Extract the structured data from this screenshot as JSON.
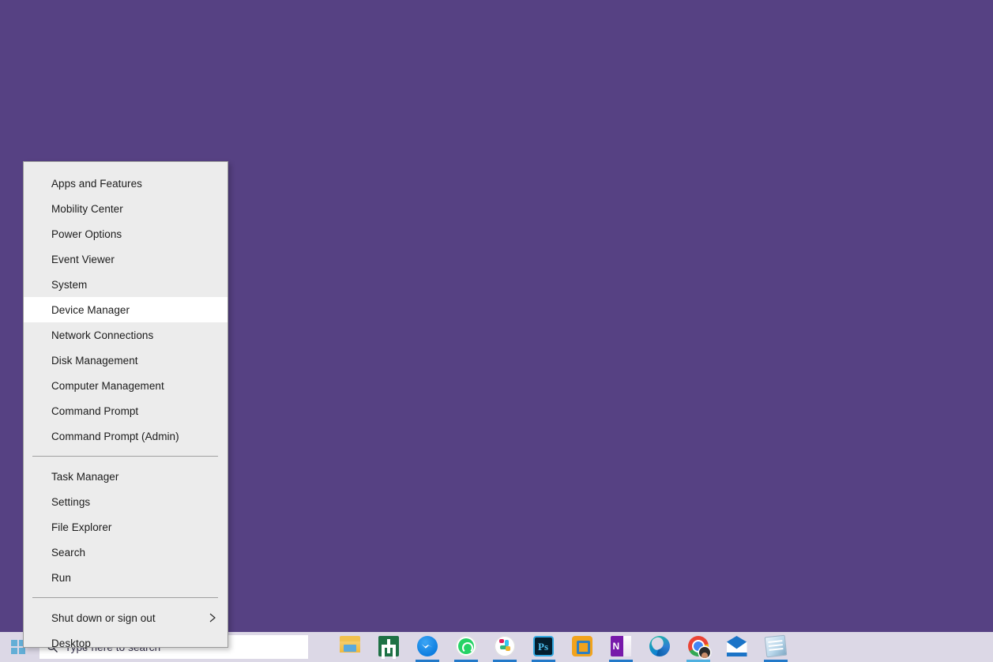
{
  "desktop": {
    "background_color": "#564183"
  },
  "power_menu": {
    "name": "Windows power user menu",
    "background_color": "#ececec",
    "highlight_color": "#ffffff",
    "groups": [
      {
        "items": [
          {
            "label": "Apps and Features",
            "selected": false,
            "submenu": false
          },
          {
            "label": "Mobility Center",
            "selected": false,
            "submenu": false
          },
          {
            "label": "Power Options",
            "selected": false,
            "submenu": false
          },
          {
            "label": "Event Viewer",
            "selected": false,
            "submenu": false
          },
          {
            "label": "System",
            "selected": false,
            "submenu": false
          },
          {
            "label": "Device Manager",
            "selected": true,
            "submenu": false
          },
          {
            "label": "Network Connections",
            "selected": false,
            "submenu": false
          },
          {
            "label": "Disk Management",
            "selected": false,
            "submenu": false
          },
          {
            "label": "Computer Management",
            "selected": false,
            "submenu": false
          },
          {
            "label": "Command Prompt",
            "selected": false,
            "submenu": false
          },
          {
            "label": "Command Prompt (Admin)",
            "selected": false,
            "submenu": false
          }
        ]
      },
      {
        "items": [
          {
            "label": "Task Manager",
            "selected": false,
            "submenu": false
          },
          {
            "label": "Settings",
            "selected": false,
            "submenu": false
          },
          {
            "label": "File Explorer",
            "selected": false,
            "submenu": false
          },
          {
            "label": "Search",
            "selected": false,
            "submenu": false
          },
          {
            "label": "Run",
            "selected": false,
            "submenu": false
          }
        ]
      },
      {
        "items": [
          {
            "label": "Shut down or sign out",
            "selected": false,
            "submenu": true
          },
          {
            "label": "Desktop",
            "selected": false,
            "submenu": false
          }
        ]
      }
    ]
  },
  "taskbar": {
    "background_color": "#dcd8e6",
    "start_button": {
      "icon": "windows-logo-icon",
      "color": "#63aed6"
    },
    "search": {
      "icon": "search-icon",
      "placeholder": "Type here to search",
      "value": "",
      "background_color": "#ffffff"
    },
    "pinned_apps": [
      {
        "name": "file-explorer",
        "label": "File Explorer",
        "running": false
      },
      {
        "name": "excel",
        "label": "Excel",
        "running": false
      },
      {
        "name": "messenger",
        "label": "Messenger",
        "running": true
      },
      {
        "name": "whatsapp",
        "label": "WhatsApp",
        "running": true
      },
      {
        "name": "slack",
        "label": "Slack",
        "running": true
      },
      {
        "name": "photoshop",
        "label": "Adobe Photoshop",
        "running": true
      },
      {
        "name": "vmware",
        "label": "VMware Workstation",
        "running": false
      },
      {
        "name": "onenote",
        "label": "OneNote",
        "running": true
      },
      {
        "name": "edge",
        "label": "Microsoft Edge",
        "running": false
      },
      {
        "name": "chrome",
        "label": "Google Chrome",
        "running": true
      },
      {
        "name": "mail",
        "label": "Mail",
        "running": false
      },
      {
        "name": "notes",
        "label": "Notes",
        "running": true
      }
    ]
  }
}
